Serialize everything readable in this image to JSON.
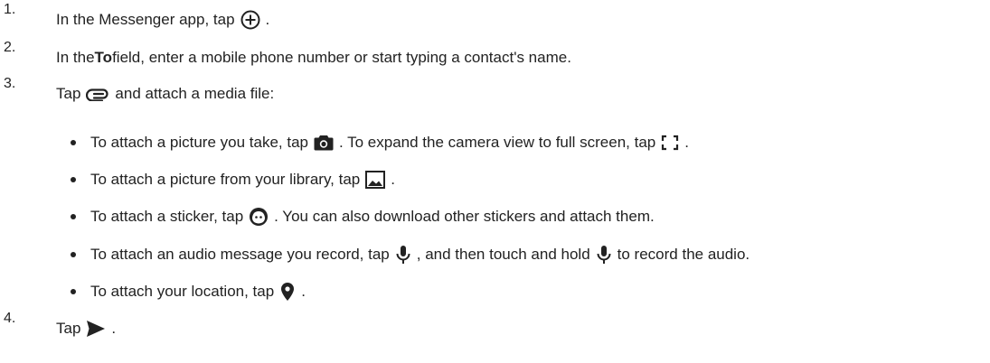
{
  "steps": [
    {
      "number": "1.",
      "before": "In the Messenger app, tap",
      "icon": "add-circle-icon",
      "after": "."
    },
    {
      "number": "2.",
      "before": "In the ",
      "bold": "To",
      "after": " field, enter a mobile phone number or start typing a contact's name."
    },
    {
      "number": "3.",
      "before": "Tap",
      "icon": "attachment-icon",
      "after": "and attach a media file:"
    },
    {
      "number": "4.",
      "before": "Tap",
      "icon": "send-icon",
      "after": "."
    }
  ],
  "bullets": [
    {
      "part1": "To attach a picture you take, tap",
      "icon1": "camera-icon",
      "part2": ". To expand the camera view to full screen, tap",
      "icon2": "fullscreen-icon",
      "part3": "."
    },
    {
      "part1": "To attach a picture from your library, tap",
      "icon1": "gallery-icon",
      "part2": "."
    },
    {
      "part1": "To attach a sticker, tap",
      "icon1": "sticker-icon",
      "part2": ". You can also download other stickers and attach them."
    },
    {
      "part1": "To attach an audio message you record, tap",
      "icon1": "microphone-icon",
      "part2": ", and then touch and hold",
      "icon2": "microphone-icon",
      "part3": "to record the audio."
    },
    {
      "part1": "To attach your location, tap",
      "icon1": "location-pin-icon",
      "part2": "."
    }
  ]
}
